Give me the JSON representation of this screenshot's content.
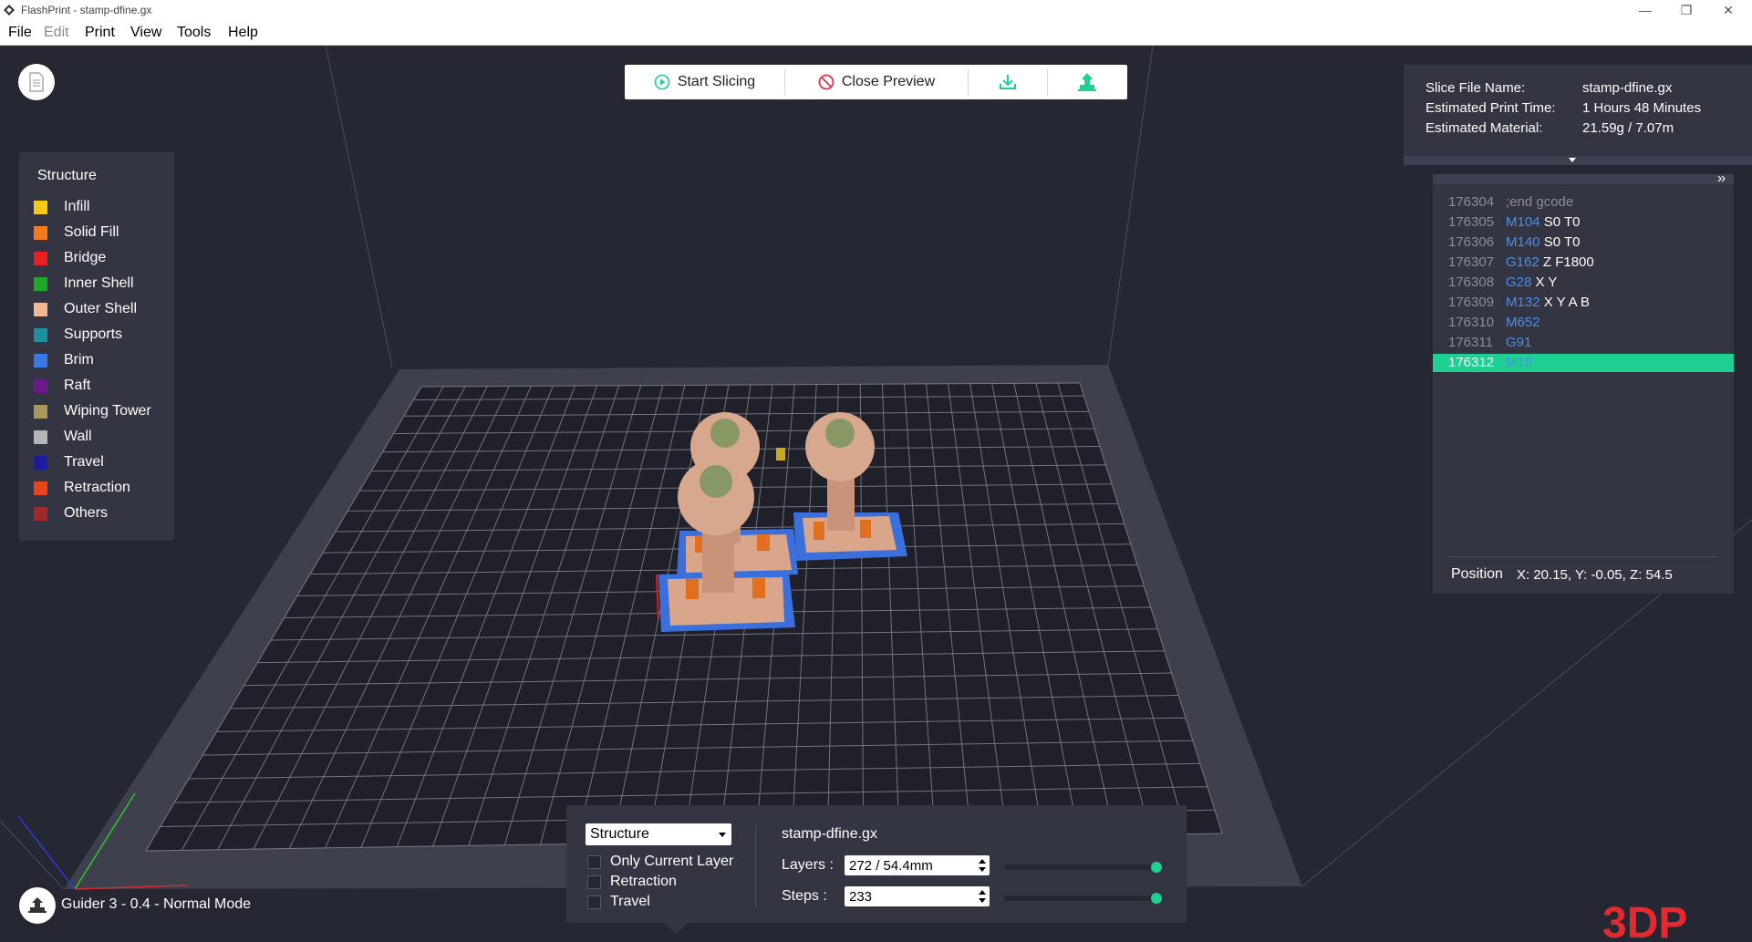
{
  "window": {
    "title": "FlashPrint - stamp-dfine.gx",
    "minimize_glyph": "—",
    "maximize_glyph": "❐",
    "close_glyph": "✕"
  },
  "menu": {
    "items": [
      {
        "label": "File",
        "enabled": true
      },
      {
        "label": "Edit",
        "enabled": false
      },
      {
        "label": "Print",
        "enabled": true
      },
      {
        "label": "View",
        "enabled": true
      },
      {
        "label": "Tools",
        "enabled": true
      },
      {
        "label": "Help",
        "enabled": true
      }
    ]
  },
  "toolbar": {
    "start_slicing": "Start Slicing",
    "close_preview": "Close Preview",
    "accent_color": "#1ed091",
    "stop_color": "#e0334a",
    "export_icon": "download-icon",
    "print_icon": "print-send-icon"
  },
  "legend": {
    "title": "Structure",
    "items": [
      {
        "label": "Infill",
        "color": "#f6c915"
      },
      {
        "label": "Solid Fill",
        "color": "#f37b1d"
      },
      {
        "label": "Bridge",
        "color": "#e82020"
      },
      {
        "label": "Inner Shell",
        "color": "#1ea72b"
      },
      {
        "label": "Outer Shell",
        "color": "#f3b896"
      },
      {
        "label": "Supports",
        "color": "#1e8f9e"
      },
      {
        "label": "Brim",
        "color": "#3b78e7"
      },
      {
        "label": "Raft",
        "color": "#6b1a8c"
      },
      {
        "label": "Wiping Tower",
        "color": "#a59a5a"
      },
      {
        "label": "Wall",
        "color": "#b5b5b5"
      },
      {
        "label": "Travel",
        "color": "#1c1c9e"
      },
      {
        "label": "Retraction",
        "color": "#e8461a"
      },
      {
        "label": "Others",
        "color": "#9e2a2a"
      }
    ]
  },
  "info": {
    "slice_file_label": "Slice File Name:",
    "slice_file_value": "stamp-dfine.gx",
    "print_time_label": "Estimated Print Time:",
    "print_time_value": "1 Hours 48 Minutes",
    "material_label": "Estimated Material:",
    "material_value": "21.59g / 7.07m"
  },
  "gcode": {
    "lines": [
      {
        "num": "176304",
        "cmd": "",
        "args": ";end gcode",
        "comment": true
      },
      {
        "num": "176305",
        "cmd": "M104",
        "args": "S0 T0"
      },
      {
        "num": "176306",
        "cmd": "M140",
        "args": "S0 T0"
      },
      {
        "num": "176307",
        "cmd": "G162",
        "args": "Z F1800"
      },
      {
        "num": "176308",
        "cmd": "G28",
        "args": "X Y"
      },
      {
        "num": "176309",
        "cmd": "M132",
        "args": "X Y A B"
      },
      {
        "num": "176310",
        "cmd": "M652",
        "args": ""
      },
      {
        "num": "176311",
        "cmd": "G91",
        "args": ""
      },
      {
        "num": "176312",
        "cmd": "M18",
        "args": "",
        "active": true
      }
    ],
    "position_label": "Position",
    "position_value": "X: 20.15, Y: -0.05, Z: 54.5"
  },
  "preview": {
    "mode_select": "Structure",
    "only_current_layer": "Only Current Layer",
    "retraction": "Retraction",
    "travel": "Travel",
    "file_name": "stamp-dfine.gx",
    "layers_label": "Layers :",
    "layers_value": "272 / 54.4mm",
    "layers_fraction": 1.0,
    "steps_label": "Steps :",
    "steps_value": "233",
    "steps_fraction": 1.0
  },
  "machine": {
    "label": "Guider 3 - 0.4 - Normal Mode"
  },
  "watermark": {
    "text": "3DP"
  }
}
